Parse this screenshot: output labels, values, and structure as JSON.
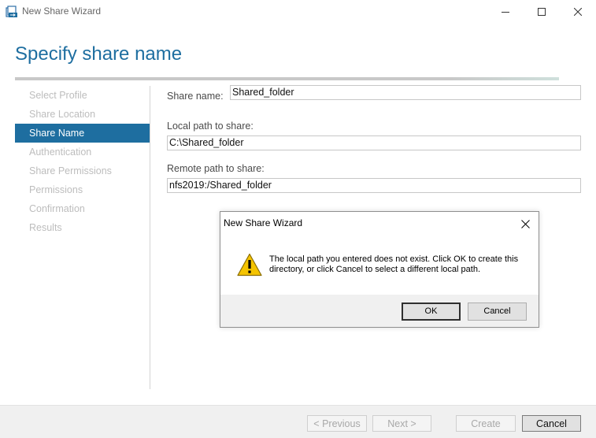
{
  "window": {
    "title": "New Share Wizard",
    "icon": "share-wizard-icon"
  },
  "header": {
    "title": "Specify share name"
  },
  "nav": {
    "items": [
      {
        "label": "Select Profile",
        "state": "disabled"
      },
      {
        "label": "Share Location",
        "state": "disabled"
      },
      {
        "label": "Share Name",
        "state": "active"
      },
      {
        "label": "Authentication",
        "state": "disabled"
      },
      {
        "label": "Share Permissions",
        "state": "disabled"
      },
      {
        "label": "Permissions",
        "state": "disabled"
      },
      {
        "label": "Confirmation",
        "state": "disabled"
      },
      {
        "label": "Results",
        "state": "disabled"
      }
    ]
  },
  "form": {
    "share_name_label": "Share name:",
    "share_name_value": "Shared_folder",
    "local_path_label": "Local path to share:",
    "local_path_value": "C:\\Shared_folder",
    "remote_path_label": "Remote path to share:",
    "remote_path_value": "nfs2019:/Shared_folder"
  },
  "footer": {
    "previous_label": "< Previous",
    "next_label": "Next >",
    "create_label": "Create",
    "cancel_label": "Cancel"
  },
  "dialog": {
    "title": "New Share Wizard",
    "icon": "warning-icon",
    "message": "The local path you entered does not exist. Click OK to create this directory, or click Cancel to select a different local path.",
    "ok_label": "OK",
    "cancel_label": "Cancel"
  },
  "colors": {
    "accent": "#1e6ea0",
    "warning": "#f5c400"
  }
}
